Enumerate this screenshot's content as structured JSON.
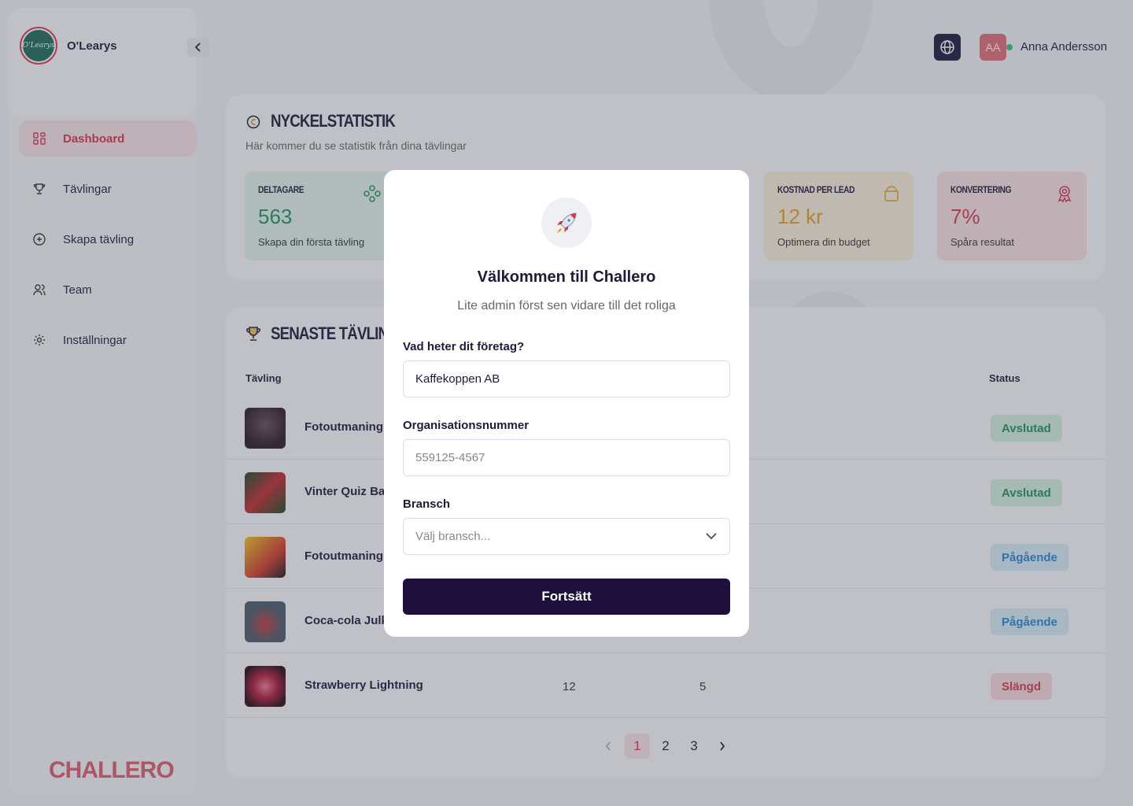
{
  "colors": {
    "accent": "#d93550",
    "primary_dark": "#1f0f3d",
    "success": "#23935a",
    "info": "#2f85c6",
    "danger": "#d43b4d"
  },
  "sidebar": {
    "brand_name": "O'Learys",
    "logo_text": "O'Learys",
    "collapse_icon": "chevron-left-icon",
    "items": [
      {
        "label": "Dashboard",
        "icon": "dashboard-grid-icon",
        "active": true
      },
      {
        "label": "Tävlingar",
        "icon": "trophy-icon",
        "active": false
      },
      {
        "label": "Skapa tävling",
        "icon": "plus-circle-icon",
        "active": false
      },
      {
        "label": "Team",
        "icon": "users-icon",
        "active": false
      },
      {
        "label": "Inställningar",
        "icon": "gear-icon",
        "active": false
      }
    ],
    "footer_logo": "CHALLERO"
  },
  "header": {
    "language_icon": "globe-icon",
    "avatar_initials": "AA",
    "user_name": "Anna Andersson"
  },
  "stats": {
    "title": "NYCKELSTATISTIK",
    "subtitle": "Här kommer du se statistik från dina tävlingar",
    "cards": [
      {
        "label": "DELTAGARE",
        "value": "563",
        "hint": "Skapa din första tävling",
        "icon": "people-group-icon"
      },
      {
        "label": "KOSTNAD PER LEAD",
        "value": "12 kr",
        "hint": "Optimera din budget",
        "icon": "wallet-icon"
      },
      {
        "label": "KONVERTERING",
        "value": "7%",
        "hint": "Spåra resultat",
        "icon": "award-icon"
      }
    ]
  },
  "competitions": {
    "title": "SENASTE TÄVLINGAR",
    "columns": {
      "name": "Tävling",
      "status": "Status"
    },
    "rows": [
      {
        "name": "Fotoutmaning -",
        "status": "Avslutad",
        "status_type": "done"
      },
      {
        "name": "Vinter Quiz Bat",
        "status": "Avslutad",
        "status_type": "done"
      },
      {
        "name": "Fotoutmaning -",
        "status": "Pågående",
        "status_type": "ongoing"
      },
      {
        "name": "Coca-cola Julk",
        "status": "Pågående",
        "status_type": "ongoing"
      },
      {
        "name": "Strawberry Lightning",
        "col2": "12",
        "col3": "5",
        "status": "Slängd",
        "status_type": "thrown"
      }
    ],
    "pagination": {
      "pages": [
        "1",
        "2",
        "3"
      ],
      "current": "1"
    }
  },
  "modal": {
    "icon": "rocket-icon",
    "title": "Välkommen till Challero",
    "subtitle": "Lite admin först sen vidare till det roliga",
    "company_label": "Vad heter dit företag?",
    "company_value": "Kaffekoppen AB",
    "org_label": "Organisationsnummer",
    "org_placeholder": "559125-4567",
    "industry_label": "Bransch",
    "industry_placeholder": "Välj bransch...",
    "submit_label": "Fortsätt"
  }
}
